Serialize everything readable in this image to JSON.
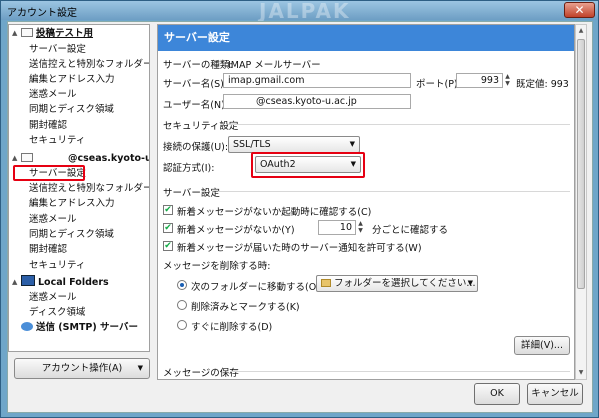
{
  "window": {
    "title": "アカウント設定",
    "watermark": "JALPAK",
    "close": "✕"
  },
  "sidebar": {
    "account1": {
      "label": "投稿テスト用",
      "children": [
        "サーバー設定",
        "送信控えと特別なフォルダー",
        "編集とアドレス入力",
        "迷惑メール",
        "同期とディスク領域",
        "開封確認",
        "セキュリティ"
      ]
    },
    "account2": {
      "label": "@cseas.kyoto-u....",
      "children": [
        "サーバー設定",
        "送信控えと特別なフォルダー",
        "編集とアドレス入力",
        "迷惑メール",
        "同期とディスク領域",
        "開封確認",
        "セキュリティ"
      ]
    },
    "local": {
      "label": "Local Folders",
      "children": [
        "迷惑メール",
        "ディスク領域"
      ]
    },
    "smtp": {
      "label": "送信 (SMTP) サーバー"
    },
    "account_actions": "アカウント操作(A)"
  },
  "main": {
    "banner": "サーバー設定",
    "server_type_label": "サーバーの種類:",
    "server_type_value": "IMAP メールサーバー",
    "server_name_label": "サーバー名(S):",
    "server_name_value": "imap.gmail.com",
    "port_label": "ポート(P):",
    "port_value": "993",
    "default_port": "既定値: 993",
    "username_label": "ユーザー名(N):",
    "username_value": "@cseas.kyoto-u.ac.jp",
    "security_heading": "セキュリティ設定",
    "connection_security_label": "接続の保護(U):",
    "connection_security_value": "SSL/TLS",
    "auth_method_label": "認証方式(I):",
    "auth_method_value": "OAuth2",
    "server_settings_heading": "サーバー設定",
    "check_startup": "新着メッセージがないか起動時に確認する(C)",
    "check_every": "新着メッセージがないか(Y)",
    "check_minutes": "10",
    "check_every_suffix": "分ごとに確認する",
    "allow_push": "新着メッセージが届いた時のサーバー通知を許可する(W)",
    "on_delete_label": "メッセージを削除する時:",
    "move_to_folder": "次のフォルダーに移動する(O):",
    "folder_select": "フォルダーを選択してください...",
    "mark_deleted": "削除済みとマークする(K)",
    "delete_immediately": "すぐに削除する(D)",
    "advanced": "詳細(V)...",
    "message_storage": "メッセージの保存"
  },
  "footer": {
    "ok": "OK",
    "cancel": "キャンセル"
  }
}
